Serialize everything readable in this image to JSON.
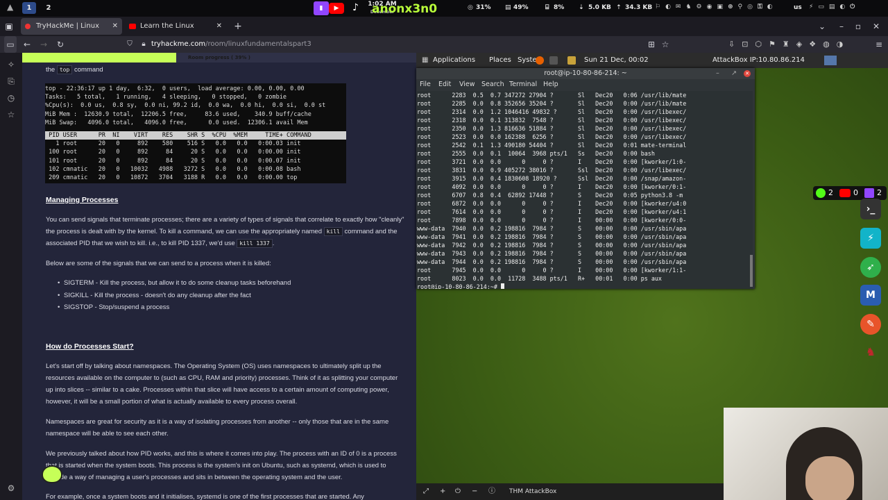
{
  "topbar": {
    "ws1": "1",
    "ws2": "2",
    "time": "1:02 AM",
    "date": "December 21 2025",
    "streamer": "anonx3n0",
    "cpu": "31%",
    "mem": "49%",
    "disk": "8%",
    "net_down": "5.0 KB",
    "net_up": "34.3 KB",
    "locale": "us",
    "mute": "Mute"
  },
  "tabs": [
    {
      "label": "TryHackMe | Linux Fundam"
    },
    {
      "label": "Learn the Linux Fundamer"
    }
  ],
  "url": {
    "domain": "tryhackme.com",
    "path": "/room/linuxfundamentalspart3"
  },
  "progress": {
    "label": "Room progress ( 39% )",
    "value": 0.39
  },
  "article": {
    "intro_pre": "the",
    "intro_code": "top",
    "intro_post": "command",
    "top_summary": "top - 22:36:17 up 1 day,  6:32,  0 users,  load average: 0.00, 0.00, 0.00\nTasks:   5 total,   1 running,   4 sleeping,   0 stopped,   0 zombie\n%Cpu(s):  0.0 us,  0.8 sy,  0.0 ni, 99.2 id,  0.0 wa,  0.0 hi,  0.0 si,  0.0 st\nMiB Mem :  12630.9 total,  12206.5 free,     83.6 used,    340.9 buff/cache\nMiB Swap:   4096.0 total,   4096.0 free,      0.0 used.  12306.1 avail Mem",
    "top_header": " PID USER      PR  NI    VIRT    RES    SHR S  %CPU  %MEM     TIME+ COMMAND",
    "top_rows": "   1 root      20   0     892    580    516 S   0.0   0.0   0:00.03 init\n 100 root      20   0     892     84     20 S   0.0   0.0   0:00.00 init\n 101 root      20   0     892     84     20 S   0.0   0.0   0:00.07 init\n 102 cmnatic   20   0   10032   4988   3272 S   0.0   0.0   0:00.08 bash\n 209 cmnatic   20   0   10872   3704   3188 R   0.0   0.0   0:00.00 top",
    "h_managing": "Managing Processes",
    "p1a": "You can send signals that terminate processes; there are a variety of types of signals that correlate to exactly how \"cleanly\" the process is dealt with by the kernel. To kill a command, we can use the appropriately named",
    "p1_code1": "kill",
    "p1b": "command and the associated PID that we wish to kill. i.e., to kill PID 1337, we'd use",
    "p1_code2": "kill 1337",
    "p2": "Below are some of the signals that we can send to a process when it is killed:",
    "signals": [
      "SIGTERM - Kill the process, but allow it to do some cleanup tasks beforehand",
      "SIGKILL - Kill the process - doesn't do any cleanup after the fact",
      "SIGSTOP - Stop/suspend a process"
    ],
    "h_start": "How do Processes Start?",
    "p3": "Let's start off by talking about namespaces. The Operating System (OS) uses namespaces to ultimately split up the resources available on the computer to (such as CPU, RAM and priority) processes. Think of it as splitting your computer up into slices -- similar to a cake. Processes within that slice will have access to a certain amount of computing power, however, it will be a small portion of what is actually available to every process overall.",
    "p4": "Namespaces are great for security as it is a way of isolating processes from another -- only those that are in the same namespace will be able to see each other.",
    "p5": "We previously talked about how PID works, and this is where it comes into play. The process with an ID of 0 is a process that is started when the system boots. This process is the system's init on Ubuntu, such as systemd, which is used to provide a way of managing a user's processes and sits in between the operating system and the user.",
    "p6": "For example, once a system boots and it initialises, systemd is one of the first processes that are started. Any"
  },
  "attackbox": {
    "panel_apps": "Applications",
    "panel_places": "Places",
    "panel_system": "System",
    "panel_date": "Sun 21 Dec, 00:02",
    "panel_ip": "AttackBox IP:10.80.86.214",
    "term_title": "root@ip-10-80-86-214: ~",
    "term_menu": [
      "File",
      "Edit",
      "View",
      "Search",
      "Terminal",
      "Help"
    ],
    "term_output": "root      2283  0.5  0.7 347272 27904 ?       Sl   Dec20   0:06 /usr/lib/mate\nroot      2285  0.0  0.8 352656 35204 ?       Sl   Dec20   0:00 /usr/lib/mate\nroot      2314  0.0  1.2 1046416 49832 ?      Sl   Dec20   0:00 /usr/libexec/\nroot      2318  0.0  0.1 313832  7548 ?       Sl   Dec20   0:00 /usr/libexec/\nroot      2350  0.0  1.3 816636 51884 ?       Sl   Dec20   0:00 /usr/libexec/\nroot      2523  0.0  0.0 162388  6256 ?       Sl   Dec20   0:00 /usr/libexec/\nroot      2542  0.1  1.3 490180 54404 ?       Sl   Dec20   0:01 mate-terminal\nroot      2555  0.0  0.1  10064  3968 pts/1   Ss   Dec20   0:00 bash\nroot      3721  0.0  0.0      0     0 ?       I    Dec20   0:00 [kworker/1:0-\nroot      3831  0.0  0.9 405272 38016 ?       Ssl  Dec20   0:00 /usr/libexec/\nroot      3915  0.0  0.4 1830608 18920 ?      Ssl  Dec20   0:00 /snap/amazon-\nroot      4092  0.0  0.0      0     0 ?       I    Dec20   0:00 [kworker/0:1-\nroot      6707  0.8  0.4  62892 17448 ?       S    Dec20   0:05 python3.8 -m\nroot      6872  0.0  0.0      0     0 ?       I    Dec20   0:00 [kworker/u4:0\nroot      7614  0.0  0.0      0     0 ?       I    Dec20   0:00 [kworker/u4:1\nroot      7898  0.0  0.0      0     0 ?       I    00:00   0:00 [kworker/0:0-\nwww-data  7940  0.0  0.2 198816  7984 ?       S    00:00   0:00 /usr/sbin/apa\nwww-data  7941  0.0  0.2 198816  7984 ?       S    00:00   0:00 /usr/sbin/apa\nwww-data  7942  0.0  0.2 198816  7984 ?       S    00:00   0:00 /usr/sbin/apa\nwww-data  7943  0.0  0.2 198816  7984 ?       S    00:00   0:00 /usr/sbin/apa\nwww-data  7944  0.0  0.2 198816  7984 ?       S    00:00   0:00 /usr/sbin/apa\nroot      7945  0.0  0.0      0     0 ?       I    00:00   0:00 [kworker/1:1-\nroot      8023  0.0  0.0  11728  3488 pts/1   R+   00:01   0:00 ps aux",
    "prompt": "root@ip-10-80-86-214:~# ",
    "bottom_label": "THM AttackBox"
  },
  "overlay": {
    "kick_count": "2",
    "yt_count": "0",
    "twitch_count": "2"
  },
  "colors": {
    "accent": "#c6ff58",
    "thm_bg": "#23253a",
    "terminal_bg": "#2b3133"
  }
}
